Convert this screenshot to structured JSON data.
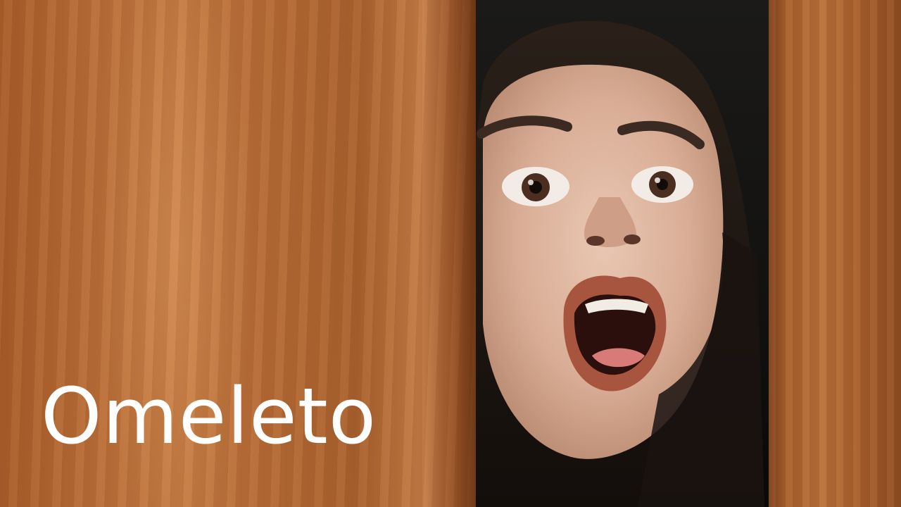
{
  "brand": {
    "wordmark": "Omeleto",
    "color": "#ffffff"
  },
  "scene": {
    "door_color": "#b86d37",
    "background_color": "#121110"
  }
}
